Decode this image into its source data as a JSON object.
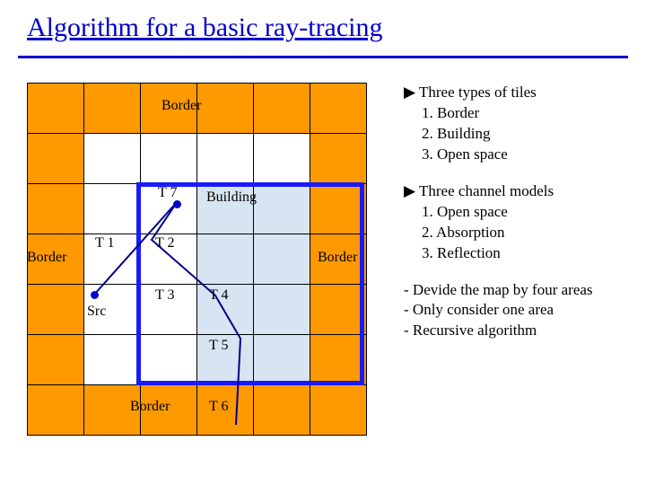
{
  "title": "Algorithm for a basic ray-tracing",
  "grid_labels": {
    "border_top": "Border",
    "border_left": "Border",
    "border_right": "Border",
    "border_bottom": "Border",
    "building": "Building",
    "t1": "T 1",
    "t2": "T 2",
    "t3": "T 3",
    "t4": "T 4",
    "t5": "T 5",
    "t6": "T 6",
    "t7": "T 7",
    "src": "Src"
  },
  "right": {
    "tiles_head": "▶ Three types of tiles",
    "tiles_1": "1. Border",
    "tiles_2": "2. Building",
    "tiles_3": "3. Open space",
    "models_head": "▶ Three channel models",
    "models_1": "1. Open space",
    "models_2": "2. Absorption",
    "models_3": "3. Reflection",
    "note_1": "- Devide the map by four areas",
    "note_2": "- Only consider one area",
    "note_3": "- Recursive algorithm"
  }
}
